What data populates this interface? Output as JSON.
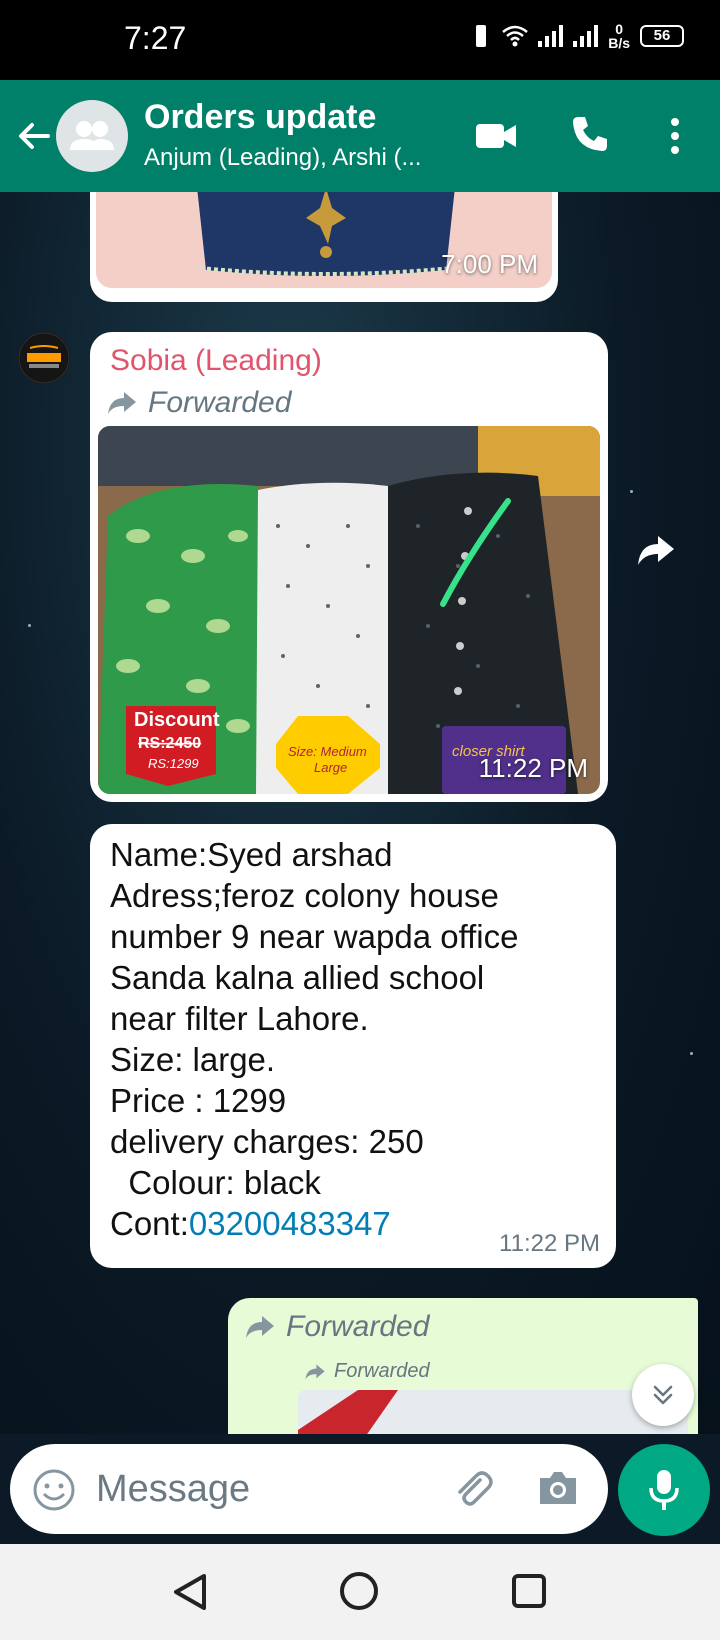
{
  "status_bar": {
    "time": "7:27",
    "net_speed_value": "0",
    "net_speed_unit": "B/s",
    "battery": "56"
  },
  "header": {
    "title": "Orders update",
    "subtitle": "Anjum (Leading), Arshi (...",
    "icons": [
      "back-arrow-icon",
      "group-avatar-icon",
      "video-call-icon",
      "phone-call-icon",
      "more-options-icon"
    ]
  },
  "messages": [
    {
      "type": "image",
      "time": "7:00 PM"
    },
    {
      "type": "image",
      "sender": "Sobia (Leading)",
      "forwarded_label": "Forwarded",
      "time": "11:22 PM",
      "image_text": {
        "discount_title": "Discount",
        "old_price": "RS:2450",
        "new_price": "RS:1299",
        "size_line1": "Size: Medium",
        "size_line2": "Large",
        "caption": "closer shirt"
      }
    },
    {
      "type": "text",
      "body": "Name:Syed arshad\nAdress;feroz colony house\nnumber 9 near wapda office\nSanda kalna allied school\nnear filter Lahore.\nSize: large.\nPrice : 1299\ndelivery charges: 250\n  Colour: black\nCont:",
      "phone_link": "03200483347",
      "time": "11:22 PM"
    },
    {
      "type": "forwarded",
      "forwarded_label": "Forwarded",
      "inner_forwarded_label": "Forwarded"
    }
  ],
  "input": {
    "placeholder": "Message"
  },
  "colors": {
    "header": "#008069",
    "accent": "#00a884",
    "sender_name": "#e0556c",
    "link": "#027eb5"
  }
}
